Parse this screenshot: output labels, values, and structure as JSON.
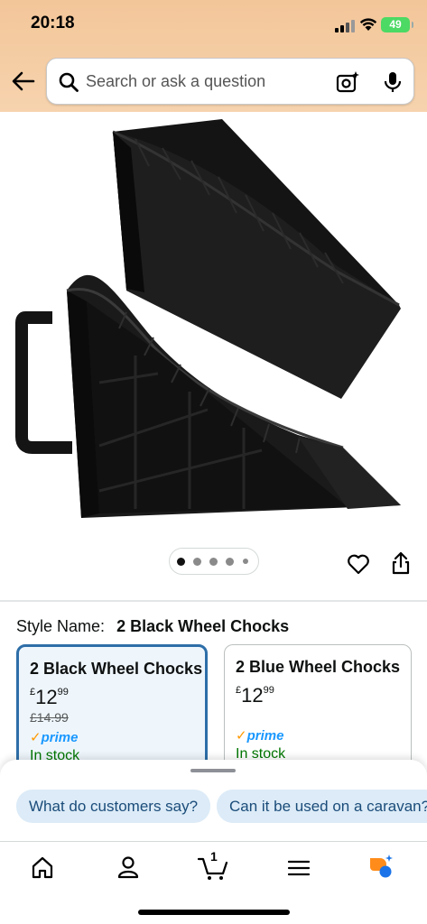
{
  "status_bar": {
    "time": "20:18",
    "battery": "49"
  },
  "search": {
    "placeholder": "Search or ask a question"
  },
  "style": {
    "label": "Style Name:",
    "value": "2 Black Wheel Chocks",
    "options": [
      {
        "title": "2 Black Wheel Chocks",
        "currency": "£",
        "price_whole": "12",
        "price_fraction": "99",
        "old_price": "£14.99",
        "prime": "prime",
        "stock": "In stock",
        "selected": true
      },
      {
        "title": "2 Blue Wheel Chocks",
        "currency": "£",
        "price_whole": "12",
        "price_fraction": "99",
        "old_price": "",
        "prime": "prime",
        "stock": "In stock",
        "selected": false
      }
    ]
  },
  "carousel": {
    "total": 5,
    "active": 1
  },
  "suggestions": [
    "What do customers say?",
    "Can it be used on a caravan?"
  ],
  "tabbar": {
    "cart_count": "1",
    "items": [
      "home-icon",
      "account-icon",
      "cart-icon",
      "menu-icon",
      "rufus-icon"
    ]
  },
  "colors": {
    "header_bg": "#f3c699",
    "selected_border": "#2d6ea8",
    "prime_blue": "#1a98ff",
    "in_stock": "#007600",
    "chip_bg": "#dcebf7"
  }
}
